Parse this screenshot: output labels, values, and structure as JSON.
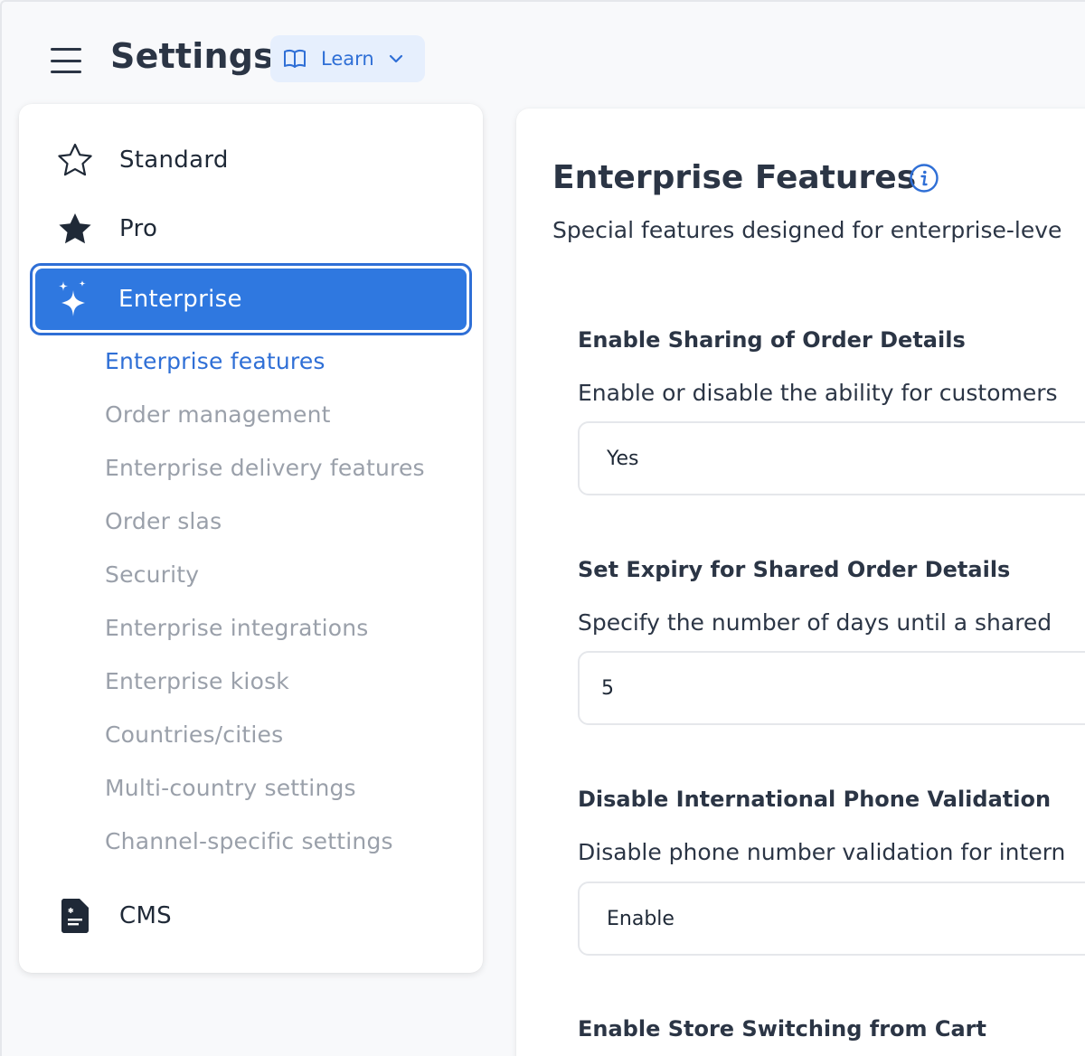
{
  "header": {
    "title": "Settings",
    "learn_label": "Learn"
  },
  "sidebar": {
    "tiers": [
      {
        "label": "Standard",
        "icon": "star-outline-icon"
      },
      {
        "label": "Pro",
        "icon": "star-filled-icon"
      },
      {
        "label": "Enterprise",
        "icon": "sparkles-icon",
        "selected": true
      },
      {
        "label": "CMS",
        "icon": "document-icon"
      }
    ],
    "enterprise_items": [
      {
        "label": "Enterprise features",
        "active": true
      },
      {
        "label": "Order management"
      },
      {
        "label": "Enterprise delivery features"
      },
      {
        "label": "Order slas"
      },
      {
        "label": "Security"
      },
      {
        "label": "Enterprise integrations"
      },
      {
        "label": "Enterprise kiosk"
      },
      {
        "label": "Countries/cities"
      },
      {
        "label": "Multi-country settings"
      },
      {
        "label": "Channel-specific settings"
      }
    ]
  },
  "main": {
    "title": "Enterprise Features",
    "description": "Special features designed for enterprise-leve",
    "fields": [
      {
        "title": "Enable Sharing of Order Details",
        "description": "Enable or disable the ability for customers",
        "value": "Yes",
        "kind": "select"
      },
      {
        "title": "Set Expiry for Shared Order Details",
        "description": "Specify the number of days until a shared",
        "value": "5",
        "kind": "input"
      },
      {
        "title": "Disable International Phone Validation",
        "description": "Disable phone number validation for intern",
        "value": "Enable",
        "kind": "select"
      },
      {
        "title": "Enable Store Switching from Cart",
        "kind": "select"
      }
    ]
  },
  "colors": {
    "accent": "#2f78e0",
    "accent_dark": "#2f6fd6",
    "learn_bg": "#e6effd",
    "muted_text": "#9aa0aa",
    "heading_text": "#2b3545"
  }
}
